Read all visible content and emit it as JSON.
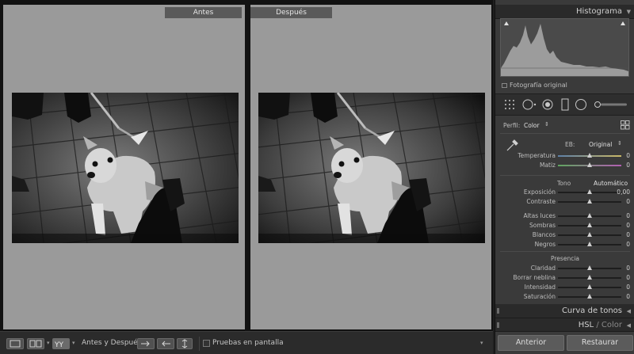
{
  "compare": {
    "before_label": "Antes",
    "after_label": "Después"
  },
  "toolbar": {
    "before_after_label": "Antes y Después:",
    "soft_proofing_label": "Pruebas en pantalla",
    "icons": [
      "loupe-view-icon",
      "before-after-view-icon",
      "before-after-split-icon",
      "swap-left-to-right-icon",
      "swap-right-to-left-icon",
      "swap-settings-icon",
      "toolbar-menu-icon"
    ]
  },
  "panel": {
    "histogram_title": "Histograma",
    "histogram_source": "Fotografía original",
    "profile_label": "Perfil:",
    "profile_value": "Color",
    "wb_label": "EB:",
    "wb_value": "Original",
    "tone_label": "Tono",
    "tone_auto": "Automático",
    "presence_label": "Presencia",
    "exposure_value": "0,00",
    "sliders": [
      {
        "label": "Temperatura",
        "value": "0",
        "position": 0.5
      },
      {
        "label": "Matiz",
        "value": "0",
        "position": 0.5
      },
      {
        "label": "Exposición",
        "value": "0,00",
        "position": 0.5
      },
      {
        "label": "Contraste",
        "value": "0",
        "position": 0.5
      },
      {
        "label": "Altas luces",
        "value": "0",
        "position": 0.5
      },
      {
        "label": "Sombras",
        "value": "0",
        "position": 0.5
      },
      {
        "label": "Blancos",
        "value": "0",
        "position": 0.5
      },
      {
        "label": "Negros",
        "value": "0",
        "position": 0.5
      },
      {
        "label": "Claridad",
        "value": "0",
        "position": 0.5
      },
      {
        "label": "Borrar neblina",
        "value": "0",
        "position": 0.5
      },
      {
        "label": "Intensidad",
        "value": "0",
        "position": 0.5
      },
      {
        "label": "Saturación",
        "value": "0",
        "position": 0.5
      }
    ],
    "tone_curve_title": "Curva de tonos",
    "hsl_title": "HSL",
    "hsl_sep": "/",
    "color_title": "Color",
    "previous_button": "Anterior",
    "reset_button": "Restaurar"
  },
  "colors": {
    "panel_bg": "#3a3a3a",
    "compare_bg": "#9a9a9a",
    "label_bg": "#5a5a5a"
  }
}
